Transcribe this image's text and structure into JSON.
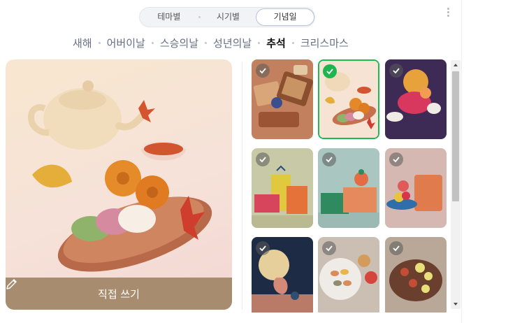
{
  "tabs": [
    {
      "label": "테마별",
      "active": false
    },
    {
      "label": "시기별",
      "active": false
    },
    {
      "label": "기념일",
      "active": true
    }
  ],
  "categories": [
    {
      "label": "새해",
      "active": false
    },
    {
      "label": "어버이날",
      "active": false
    },
    {
      "label": "스승의날",
      "active": false
    },
    {
      "label": "성년의날",
      "active": false
    },
    {
      "label": "추석",
      "active": true
    },
    {
      "label": "크리스마스",
      "active": false
    }
  ],
  "preview": {
    "write_label": "직접 쓰기",
    "write_icon": "pencil-icon",
    "illustration": "chuseok teapot and songpyeon"
  },
  "thumbnails": [
    {
      "name": "scrolls-and-cookies",
      "selected": false
    },
    {
      "name": "teapot-and-songpyeon",
      "selected": true
    },
    {
      "name": "fruit-and-clouds",
      "selected": false
    },
    {
      "name": "gift-boxes",
      "selected": false
    },
    {
      "name": "gift-box-and-fruit",
      "selected": false
    },
    {
      "name": "bird-and-fruit-bowl",
      "selected": false
    },
    {
      "name": "moon-and-rabbit",
      "selected": false
    },
    {
      "name": "plate-of-songpyeon",
      "selected": false
    },
    {
      "name": "jeon-platter",
      "selected": false
    }
  ],
  "colors": {
    "accent_selected": "#1db954",
    "button_bg": "#a88c6f",
    "active_chip": "#111111",
    "inactive_chip": "#667083"
  }
}
